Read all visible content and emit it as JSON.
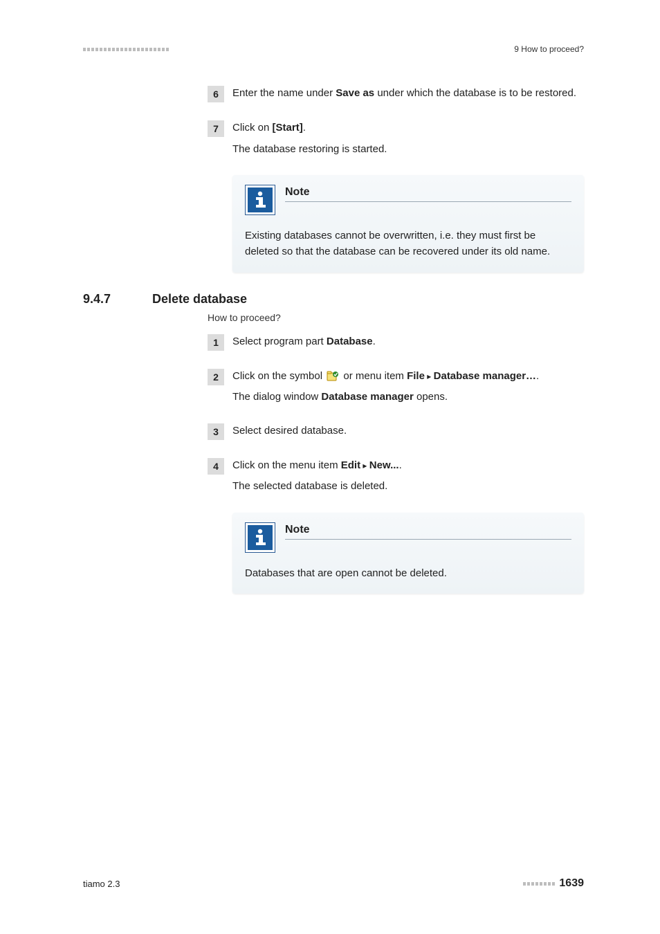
{
  "header": {
    "right": "9 How to proceed?"
  },
  "step6": {
    "num": "6",
    "text_before": "Enter the name under ",
    "bold1": "Save as",
    "text_after": " under which the database is to be restored."
  },
  "step7": {
    "num": "7",
    "line1_before": "Click on ",
    "line1_bold": "[Start]",
    "line1_after": ".",
    "line2": "The database restoring is started."
  },
  "note1": {
    "title": "Note",
    "text": "Existing databases cannot be overwritten, i.e. they must first be deleted so that the database can be recovered under its old name."
  },
  "section": {
    "num": "9.4.7",
    "title": "Delete database"
  },
  "howto": "How to proceed?",
  "d_step1": {
    "num": "1",
    "before": "Select program part ",
    "bold": "Database",
    "after": "."
  },
  "d_step2": {
    "num": "2",
    "l1_a": "Click on the symbol ",
    "l1_b": " or menu item ",
    "l1_bold1": "File",
    "l1_tri": " ▸ ",
    "l1_bold2": "Database manager…",
    "l1_end": ".",
    "l2_a": "The dialog window ",
    "l2_bold": "Database manager",
    "l2_b": " opens."
  },
  "d_step3": {
    "num": "3",
    "text": "Select desired database."
  },
  "d_step4": {
    "num": "4",
    "l1_a": "Click on the menu item ",
    "l1_bold1": "Edit",
    "l1_tri": " ▸ ",
    "l1_bold2": "New...",
    "l1_end": ".",
    "l2": "The selected database is deleted."
  },
  "note2": {
    "title": "Note",
    "text": "Databases that are open cannot be deleted."
  },
  "footer": {
    "left": "tiamo 2.3",
    "pagenum": "1639"
  }
}
